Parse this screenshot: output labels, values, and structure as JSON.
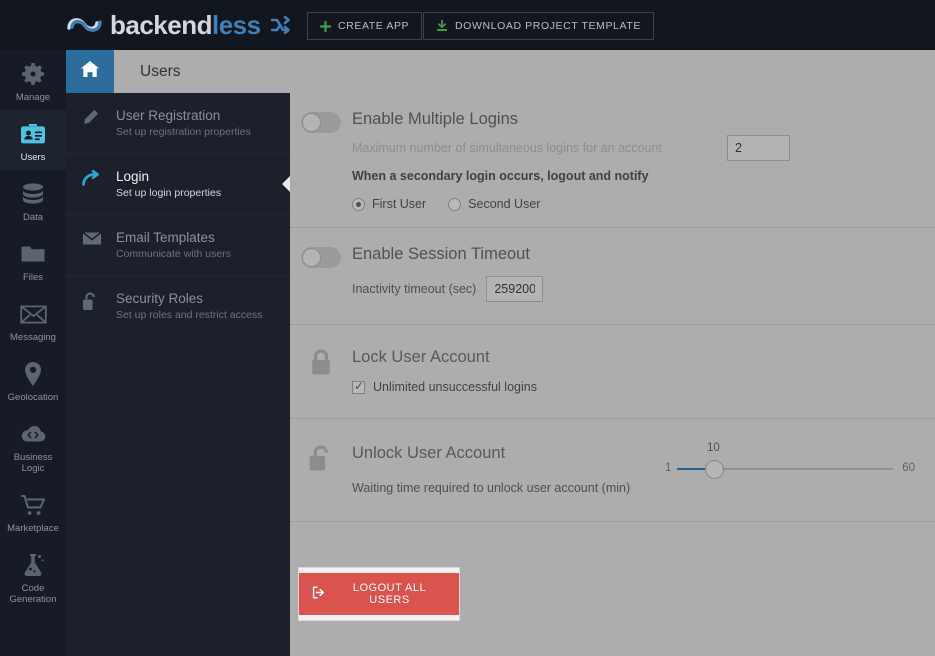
{
  "brand": {
    "logo_primary": "backend",
    "logo_accent": "less",
    "logo_mark_icon": "infinity-loop-icon",
    "logo_shuffle_icon": "shuffle-icon"
  },
  "topbar": {
    "create_app_label": "CREATE APP",
    "create_app_icon": "plus-icon",
    "download_template_label": "DOWNLOAD PROJECT TEMPLATE",
    "download_template_icon": "download-icon"
  },
  "rail": {
    "items": [
      {
        "label": "Manage",
        "icon": "gear-icon",
        "active": false
      },
      {
        "label": "Users",
        "icon": "users-card-icon",
        "active": true
      },
      {
        "label": "Data",
        "icon": "database-icon",
        "active": false
      },
      {
        "label": "Files",
        "icon": "folder-icon",
        "active": false
      },
      {
        "label": "Messaging",
        "icon": "envelope-icon",
        "active": false
      },
      {
        "label": "Geolocation",
        "icon": "map-pin-icon",
        "active": false
      },
      {
        "label": "Business Logic",
        "label_line1": "Business",
        "label_line2": "Logic",
        "icon": "code-cloud-icon",
        "active": false
      },
      {
        "label": "Marketplace",
        "icon": "shopping-cart-icon",
        "active": false
      },
      {
        "label": "Code Generation",
        "label_line1": "Code",
        "label_line2": "Generation",
        "icon": "flask-icon",
        "active": false
      }
    ]
  },
  "subnav": {
    "items": [
      {
        "title": "User Registration",
        "subtitle": "Set up registration properties",
        "icon": "pencil-icon",
        "active": false
      },
      {
        "title": "Login",
        "subtitle": "Set up login properties",
        "icon": "login-arrow-icon",
        "active": true
      },
      {
        "title": "Email Templates",
        "subtitle": "Communicate with users",
        "icon": "envelope-icon",
        "active": false
      },
      {
        "title": "Security Roles",
        "subtitle": "Set up roles and restrict access",
        "icon": "unlock-icon",
        "active": false
      }
    ]
  },
  "pagehead": {
    "home_icon": "home-icon",
    "title": "Users"
  },
  "content": {
    "multiple_logins": {
      "title": "Enable Multiple Logins",
      "toggle_state": "off",
      "max_logins_label": "Maximum number of simultaneous logins for an account",
      "max_logins_value": "2",
      "hint": "When a secondary login occurs, logout and notify",
      "radio_first_label": "First User",
      "radio_second_label": "Second User",
      "radio_selected": "First User"
    },
    "session_timeout": {
      "title": "Enable Session Timeout",
      "toggle_state": "off",
      "timeout_label": "Inactivity timeout (sec)",
      "timeout_value": "259200"
    },
    "lock_user_account": {
      "title": "Lock User Account",
      "icon": "lock-closed-icon",
      "checkbox_label": "Unlimited unsuccessful logins",
      "checkbox_checked": "true"
    },
    "unlock_user_account": {
      "title": "Unlock User Account",
      "icon": "lock-open-icon",
      "slider_label": "Waiting time required to unlock user account (min)",
      "slider_min": "1",
      "slider_max": "60",
      "slider_value": "10"
    },
    "logout": {
      "button_label": "LOGOUT ALL USERS",
      "button_icon": "logout-icon",
      "button_color": "#d9534f"
    }
  },
  "colors": {
    "topbar_bg": "#12161f",
    "rail_bg": "#161b26",
    "subnav_bg": "#1b202b",
    "content_bg": "#adadad",
    "accent_blue": "#2c6d9e",
    "active_cyan": "#4ec3e0",
    "danger_red": "#d9534f",
    "green": "#3f9d4a"
  }
}
